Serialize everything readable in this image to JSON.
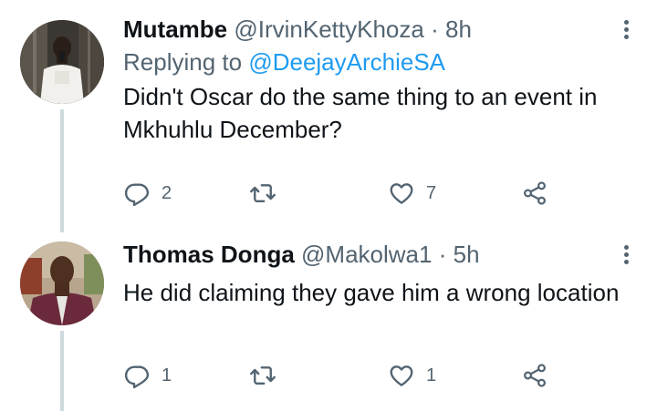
{
  "tweets": [
    {
      "display_name": "Mutambe",
      "handle": "@IrvinKettyKhoza",
      "separator": "·",
      "time": "8h",
      "replying_prefix": "Replying to",
      "replying_to": "@DeejayArchieSA",
      "text": "Didn't Oscar do the same thing to an event in Mkhuhlu December?",
      "reply_count": "2",
      "retweet_count": "",
      "like_count": "7"
    },
    {
      "display_name": "Thomas Donga",
      "handle": "@Makolwa1",
      "separator": "·",
      "time": "5h",
      "text": "He did claiming they gave him a wrong location",
      "reply_count": "1",
      "retweet_count": "",
      "like_count": "1"
    }
  ],
  "icons": {
    "reply": "reply-icon",
    "retweet": "retweet-icon",
    "like": "heart-icon",
    "share": "share-icon",
    "more": "more-icon"
  },
  "colors": {
    "text": "#0f1419",
    "secondary": "#536471",
    "link": "#1d9bf0",
    "thread_line": "#cfd9de"
  }
}
